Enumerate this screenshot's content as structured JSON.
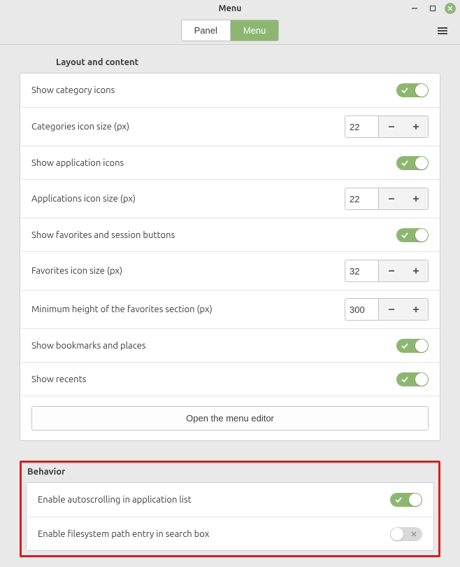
{
  "window": {
    "title": "Menu"
  },
  "tabs": {
    "panel": "Panel",
    "menu": "Menu"
  },
  "sections": {
    "layout": {
      "title": "Layout and content",
      "show_category_icons": {
        "label": "Show category icons",
        "value": true
      },
      "categories_icon_size": {
        "label": "Categories icon size (px)",
        "value": "22"
      },
      "show_application_icons": {
        "label": "Show application icons",
        "value": true
      },
      "applications_icon_size": {
        "label": "Applications icon size (px)",
        "value": "22"
      },
      "show_favorites": {
        "label": "Show favorites and session buttons",
        "value": true
      },
      "favorites_icon_size": {
        "label": "Favorites icon size (px)",
        "value": "32"
      },
      "favorites_min_height": {
        "label": "Minimum height of the favorites section (px)",
        "value": "300"
      },
      "show_bookmarks": {
        "label": "Show bookmarks and places",
        "value": true
      },
      "show_recents": {
        "label": "Show recents",
        "value": true
      },
      "open_menu_editor": "Open the menu editor"
    },
    "behavior": {
      "title": "Behavior",
      "enable_autoscroll": {
        "label": "Enable autoscrolling in application list",
        "value": true
      },
      "enable_fs_path": {
        "label": "Enable filesystem path entry in search box",
        "value": false
      }
    }
  }
}
